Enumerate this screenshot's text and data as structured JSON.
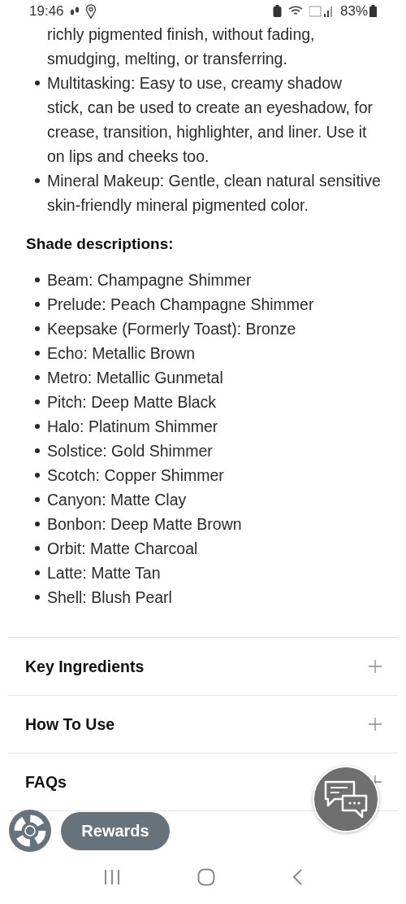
{
  "status_bar": {
    "time": "19:46",
    "battery": "83%"
  },
  "features": [
    {
      "kind": "continuation",
      "text": "richly pigmented finish, without fading, smudging, melting, or transferring."
    },
    {
      "kind": "bullet",
      "text": "Multitasking: Easy to use, creamy shadow stick, can be used to create an eyeshadow, for crease, transition, highlighter, and liner. Use it on lips and cheeks too."
    },
    {
      "kind": "bullet",
      "text": "Mineral Makeup: Gentle, clean natural sensitive skin-friendly mineral pigmented color."
    }
  ],
  "shades_heading": "Shade descriptions:",
  "shades": [
    "Beam: Champagne Shimmer",
    "Prelude: Peach Champagne Shimmer",
    "Keepsake (Formerly Toast): Bronze",
    "Echo: Metallic Brown",
    "Metro: Metallic Gunmetal",
    "Pitch: Deep Matte Black",
    "Halo: Platinum Shimmer",
    "Solstice: Gold Shimmer",
    "Scotch: Copper Shimmer",
    "Canyon: Matte Clay",
    "Bonbon: Deep Matte Brown",
    "Orbit: Matte Charcoal",
    "Latte: Matte Tan",
    "Shell: Blush Pearl"
  ],
  "accordion": [
    {
      "title": "Key Ingredients",
      "expanded": false
    },
    {
      "title": "How To Use",
      "expanded": false
    },
    {
      "title": "FAQs",
      "expanded": false
    }
  ],
  "rewards_button": "Rewards"
}
